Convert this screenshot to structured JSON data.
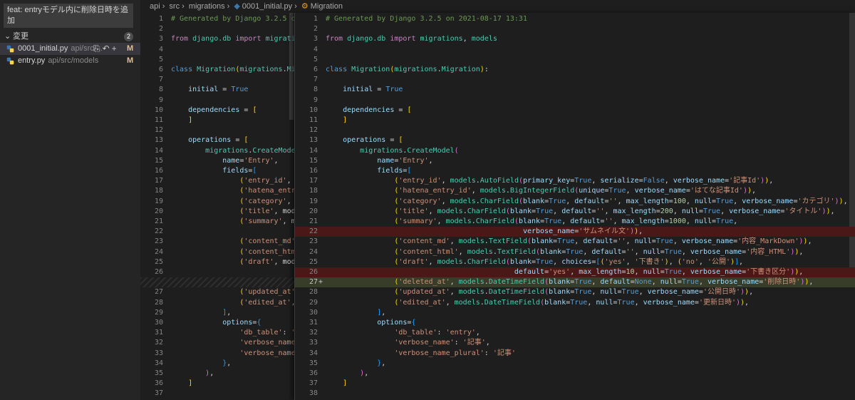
{
  "scm": {
    "commit_message": "feat: entryモデル内に削除日時を追加",
    "changes_label": "変更",
    "changes_count": "2",
    "files": [
      {
        "name": "0001_initial.py",
        "path": "api/src/...",
        "status": "M"
      },
      {
        "name": "entry.py",
        "path": "api/src/models",
        "status": "M"
      }
    ]
  },
  "breadcrumb": [
    "api",
    "src",
    "migrations",
    "0001_initial.py",
    "Migration"
  ],
  "left_lines": [
    {
      "n": "1",
      "h": "<span class='c'># Generated by Django 3.2.5 on</span>"
    },
    {
      "n": "2",
      "h": ""
    },
    {
      "n": "3",
      "h": "<span class='kw'>from</span> <span class='t'>django.db</span> <span class='kw'>import</span> <span class='t'>migrations</span>"
    },
    {
      "n": "4",
      "h": ""
    },
    {
      "n": "5",
      "h": ""
    },
    {
      "n": "6",
      "h": "<span class='k'>class</span> <span class='t'>Migration</span><span class='b1'>(</span><span class='t'>migrations</span><span class='d'>.</span><span class='t'>Mig</span>"
    },
    {
      "n": "7",
      "h": ""
    },
    {
      "n": "8",
      "h": "    <span class='p'>initial</span> <span class='d'>=</span> <span class='k'>True</span>"
    },
    {
      "n": "9",
      "h": ""
    },
    {
      "n": "10",
      "h": "    <span class='p'>dependencies</span> <span class='d'>=</span> <span class='b1'>[</span>"
    },
    {
      "n": "11",
      "h": "    <span class='b1'>]</span>"
    },
    {
      "n": "12",
      "h": ""
    },
    {
      "n": "13",
      "h": "    <span class='p'>operations</span> <span class='d'>=</span> <span class='b1'>[</span>"
    },
    {
      "n": "14",
      "h": "        <span class='t'>migrations</span><span class='d'>.</span><span class='t'>CreateModel</span>"
    },
    {
      "n": "15",
      "h": "            <span class='p'>name</span><span class='d'>=</span><span class='s'>'Entry'</span><span class='d'>,</span>"
    },
    {
      "n": "16",
      "h": "            <span class='p'>fields</span><span class='d'>=</span><span class='b3'>[</span>"
    },
    {
      "n": "17",
      "h": "                <span class='b1'>(</span><span class='s'>'entry_id'</span><span class='d'>, mo</span>"
    },
    {
      "n": "18",
      "h": "                <span class='b1'>(</span><span class='s'>'hatena_entry_</span>"
    },
    {
      "n": "19",
      "h": "                <span class='b1'>(</span><span class='s'>'category'</span><span class='d'>, m</span>"
    },
    {
      "n": "20",
      "h": "                <span class='b1'>(</span><span class='s'>'title'</span><span class='d'>, mode</span>"
    },
    {
      "n": "21",
      "h": "                <span class='b1'>(</span><span class='s'>'summary'</span><span class='d'>, mo</span>"
    },
    {
      "n": "22",
      "h": ""
    },
    {
      "n": "23",
      "h": "                <span class='b1'>(</span><span class='s'>'content_md'</span><span class='d'>,</span>"
    },
    {
      "n": "24",
      "h": "                <span class='b1'>(</span><span class='s'>'content_html</span>"
    },
    {
      "n": "25",
      "h": "                <span class='b1'>(</span><span class='s'>'draft'</span><span class='d'>, mode</span>"
    },
    {
      "n": "26",
      "h": ""
    },
    {
      "n": "",
      "h": "",
      "hatch": true
    },
    {
      "n": "27",
      "h": "                <span class='b1'>(</span><span class='s'>'updated_at'</span><span class='d'>,</span>"
    },
    {
      "n": "28",
      "h": "                <span class='b1'>(</span><span class='s'>'edited_at'</span><span class='d'>, m</span>"
    },
    {
      "n": "29",
      "h": "            <span class='b3'>]</span><span class='d'>,</span>"
    },
    {
      "n": "30",
      "h": "            <span class='p'>options</span><span class='d'>=</span><span class='b3'>{</span>"
    },
    {
      "n": "31",
      "h": "                <span class='s'>'db_table'</span><span class='d'>: </span><span class='s'>'e</span>"
    },
    {
      "n": "32",
      "h": "                <span class='s'>'verbose_name'</span>"
    },
    {
      "n": "33",
      "h": "                <span class='s'>'verbose_name_p</span>"
    },
    {
      "n": "34",
      "h": "            <span class='b3'>}</span><span class='d'>,</span>"
    },
    {
      "n": "35",
      "h": "        <span class='b2'>)</span><span class='d'>,</span>"
    },
    {
      "n": "36",
      "h": "    <span class='b1'>]</span>"
    },
    {
      "n": "37",
      "h": ""
    }
  ],
  "right_lines": [
    {
      "n": "1",
      "h": "<span class='c'># Generated by Django 3.2.5 on 2021-08-17 13:31</span>"
    },
    {
      "n": "2",
      "h": ""
    },
    {
      "n": "3",
      "h": "<span class='kw'>from</span> <span class='t'>django.db</span> <span class='kw'>import</span> <span class='t'>migrations</span><span class='d'>, </span><span class='t'>models</span>"
    },
    {
      "n": "4",
      "h": ""
    },
    {
      "n": "5",
      "h": ""
    },
    {
      "n": "6",
      "h": "<span class='k'>class</span> <span class='t'>Migration</span><span class='b1'>(</span><span class='t'>migrations</span><span class='d'>.</span><span class='t'>Migration</span><span class='b1'>)</span><span class='d'>:</span>"
    },
    {
      "n": "7",
      "h": ""
    },
    {
      "n": "8",
      "h": "    <span class='p'>initial</span> <span class='d'>=</span> <span class='k'>True</span>"
    },
    {
      "n": "9",
      "h": ""
    },
    {
      "n": "10",
      "h": "    <span class='p'>dependencies</span> <span class='d'>=</span> <span class='b1'>[</span>"
    },
    {
      "n": "11",
      "h": "    <span class='b1'>]</span>"
    },
    {
      "n": "12",
      "h": ""
    },
    {
      "n": "13",
      "h": "    <span class='p'>operations</span> <span class='d'>=</span> <span class='b1'>[</span>"
    },
    {
      "n": "14",
      "h": "        <span class='t'>migrations</span><span class='d'>.</span><span class='t'>CreateModel</span><span class='b2'>(</span>"
    },
    {
      "n": "15",
      "h": "            <span class='p'>name</span><span class='d'>=</span><span class='s'>'Entry'</span><span class='d'>,</span>"
    },
    {
      "n": "16",
      "h": "            <span class='p'>fields</span><span class='d'>=</span><span class='b3'>[</span>"
    },
    {
      "n": "17",
      "h": "                <span class='b1'>(</span><span class='s'>'entry_id'</span><span class='d'>, </span><span class='t'>models</span><span class='d'>.</span><span class='t'>AutoField</span><span class='b2'>(</span><span class='p'>primary_key</span><span class='d'>=</span><span class='k'>True</span><span class='d'>, </span><span class='p'>serialize</span><span class='d'>=</span><span class='k'>False</span><span class='d'>, </span><span class='p'>verbose_name</span><span class='d'>=</span><span class='s'>'記事Id'</span><span class='b2'>)</span><span class='b1'>)</span><span class='d'>,</span>"
    },
    {
      "n": "18",
      "h": "                <span class='b1'>(</span><span class='s'>'hatena_entry_id'</span><span class='d'>, </span><span class='t'>models</span><span class='d'>.</span><span class='t'>BigIntegerField</span><span class='b2'>(</span><span class='p'>unique</span><span class='d'>=</span><span class='k'>True</span><span class='d'>, </span><span class='p'>verbose_name</span><span class='d'>=</span><span class='s'>'はてな記事Id'</span><span class='b2'>)</span><span class='b1'>)</span><span class='d'>,</span>"
    },
    {
      "n": "19",
      "h": "                <span class='b1'>(</span><span class='s'>'category'</span><span class='d'>, </span><span class='t'>models</span><span class='d'>.</span><span class='t'>CharField</span><span class='b2'>(</span><span class='p'>blank</span><span class='d'>=</span><span class='k'>True</span><span class='d'>, </span><span class='p'>default</span><span class='d'>=</span><span class='s'>''</span><span class='d'>, </span><span class='p'>max_length</span><span class='d'>=</span><span class='n'>100</span><span class='d'>, </span><span class='p'>null</span><span class='d'>=</span><span class='k'>True</span><span class='d'>, </span><span class='p'>verbose_name</span><span class='d'>=</span><span class='s'>'カテゴリ'</span><span class='b2'>)</span><span class='b1'>)</span><span class='d'>,</span>"
    },
    {
      "n": "20",
      "h": "                <span class='b1'>(</span><span class='s'>'title'</span><span class='d'>, </span><span class='t'>models</span><span class='d'>.</span><span class='t'>CharField</span><span class='b2'>(</span><span class='p'>blank</span><span class='d'>=</span><span class='k'>True</span><span class='d'>, </span><span class='p'>default</span><span class='d'>=</span><span class='s'>''</span><span class='d'>, </span><span class='p'>max_length</span><span class='d'>=</span><span class='n'>200</span><span class='d'>, </span><span class='p'>null</span><span class='d'>=</span><span class='k'>True</span><span class='d'>, </span><span class='p'>verbose_name</span><span class='d'>=</span><span class='s'>'タイトル'</span><span class='b2'>)</span><span class='b1'>)</span><span class='d'>,</span>"
    },
    {
      "n": "21",
      "h": "                <span class='b1'>(</span><span class='s'>'summary'</span><span class='d'>, </span><span class='t'>models</span><span class='d'>.</span><span class='t'>CharField</span><span class='b2'>(</span><span class='p'>blank</span><span class='d'>=</span><span class='k'>True</span><span class='d'>, </span><span class='p'>default</span><span class='d'>=</span><span class='s'>''</span><span class='d'>, </span><span class='p'>max_length</span><span class='d'>=</span><span class='n'>1000</span><span class='d'>, </span><span class='p'>null</span><span class='d'>=</span><span class='k'>True</span><span class='d'>,</span>"
    },
    {
      "n": "22",
      "h": "                                              <span class='p'>verbose_name</span><span class='d'>=</span><span class='s'>'サムネイル文'</span><span class='b2'>)</span><span class='b1'>)</span><span class='d'>,</span>",
      "del": true
    },
    {
      "n": "23",
      "h": "                <span class='b1'>(</span><span class='s'>'content_md'</span><span class='d'>, </span><span class='t'>models</span><span class='d'>.</span><span class='t'>TextField</span><span class='b2'>(</span><span class='p'>blank</span><span class='d'>=</span><span class='k'>True</span><span class='d'>, </span><span class='p'>default</span><span class='d'>=</span><span class='s'>''</span><span class='d'>, </span><span class='p'>null</span><span class='d'>=</span><span class='k'>True</span><span class='d'>, </span><span class='p'>verbose_name</span><span class='d'>=</span><span class='s'>'内容_MarkDown'</span><span class='b2'>)</span><span class='b1'>)</span><span class='d'>,</span>"
    },
    {
      "n": "24",
      "h": "                <span class='b1'>(</span><span class='s'>'content_html'</span><span class='d'>, </span><span class='t'>models</span><span class='d'>.</span><span class='t'>TextField</span><span class='b2'>(</span><span class='p'>blank</span><span class='d'>=</span><span class='k'>True</span><span class='d'>, </span><span class='p'>default</span><span class='d'>=</span><span class='s'>''</span><span class='d'>, </span><span class='p'>null</span><span class='d'>=</span><span class='k'>True</span><span class='d'>, </span><span class='p'>verbose_name</span><span class='d'>=</span><span class='s'>'内容_HTML'</span><span class='b2'>)</span><span class='b1'>)</span><span class='d'>,</span>"
    },
    {
      "n": "25",
      "h": "                <span class='b1'>(</span><span class='s'>'draft'</span><span class='d'>, </span><span class='t'>models</span><span class='d'>.</span><span class='t'>CharField</span><span class='b2'>(</span><span class='p'>blank</span><span class='d'>=</span><span class='k'>True</span><span class='d'>, </span><span class='p'>choices</span><span class='d'>=</span><span class='b3'>[</span><span class='b1'>(</span><span class='s'>'yes'</span><span class='d'>, </span><span class='s'>'下書き'</span><span class='b1'>)</span><span class='d'>, </span><span class='b1'>(</span><span class='s'>'no'</span><span class='d'>, </span><span class='s'>'公開'</span><span class='b1'>)</span><span class='b3'>]</span><span class='d'>,</span>"
    },
    {
      "n": "26",
      "h": "                                            <span class='p'>default</span><span class='d'>=</span><span class='s'>'yes'</span><span class='d'>, </span><span class='p'>max_length</span><span class='d'>=</span><span class='n'>10</span><span class='d'>, </span><span class='p'>null</span><span class='d'>=</span><span class='k'>True</span><span class='d'>, </span><span class='p'>verbose_name</span><span class='d'>=</span><span class='s'>'下書き区分'</span><span class='b2'>)</span><span class='b1'>)</span><span class='d'>,</span>",
      "del": true
    },
    {
      "n": "27",
      "h": "                <span class='b1'>(</span><span class='s'>'deleted_at'</span><span class='d'>, </span><span class='t'>models</span><span class='d'>.</span><span class='t'>DateTimeField</span><span class='b2'>(</span><span class='p'>blank</span><span class='d'>=</span><span class='k'>True</span><span class='d'>, </span><span class='p'>default</span><span class='d'>=</span><span class='k'>None</span><span class='d'>, </span><span class='p'>null</span><span class='d'>=</span><span class='k'>True</span><span class='d'>, </span><span class='p'>verbose_name</span><span class='d'>=</span><span class='s'>'削除日時'</span><span class='b2'>)</span><span class='b1'>)</span><span class='d'>,</span>",
      "add": true
    },
    {
      "n": "28",
      "h": "                <span class='b1'>(</span><span class='s'>'updated_at'</span><span class='d'>, </span><span class='t'>models</span><span class='d'>.</span><span class='t'>DateTimeField</span><span class='b2'>(</span><span class='p'>blank</span><span class='d'>=</span><span class='k'>True</span><span class='d'>, </span><span class='p'>null</span><span class='d'>=</span><span class='k'>True</span><span class='d'>, </span><span class='p'>verbose_name</span><span class='d'>=</span><span class='s'>'公開日時'</span><span class='b2'>)</span><span class='b1'>)</span><span class='d'>,</span>"
    },
    {
      "n": "29",
      "h": "                <span class='b1'>(</span><span class='s'>'edited_at'</span><span class='d'>, </span><span class='t'>models</span><span class='d'>.</span><span class='t'>DateTimeField</span><span class='b2'>(</span><span class='p'>blank</span><span class='d'>=</span><span class='k'>True</span><span class='d'>, </span><span class='p'>null</span><span class='d'>=</span><span class='k'>True</span><span class='d'>, </span><span class='p'>verbose_name</span><span class='d'>=</span><span class='s'>'更新日時'</span><span class='b2'>)</span><span class='b1'>)</span><span class='d'>,</span>"
    },
    {
      "n": "30",
      "h": "            <span class='b3'>]</span><span class='d'>,</span>"
    },
    {
      "n": "31",
      "h": "            <span class='p'>options</span><span class='d'>=</span><span class='b3'>{</span>"
    },
    {
      "n": "32",
      "h": "                <span class='s'>'db_table'</span><span class='d'>: </span><span class='s'>'entry'</span><span class='d'>,</span>"
    },
    {
      "n": "33",
      "h": "                <span class='s'>'verbose_name'</span><span class='d'>: </span><span class='s'>'記事'</span><span class='d'>,</span>"
    },
    {
      "n": "34",
      "h": "                <span class='s'>'verbose_name_plural'</span><span class='d'>: </span><span class='s'>'記事'</span>"
    },
    {
      "n": "35",
      "h": "            <span class='b3'>}</span><span class='d'>,</span>"
    },
    {
      "n": "36",
      "h": "        <span class='b2'>)</span><span class='d'>,</span>"
    },
    {
      "n": "37",
      "h": "    <span class='b1'>]</span>"
    },
    {
      "n": "38",
      "h": ""
    }
  ]
}
